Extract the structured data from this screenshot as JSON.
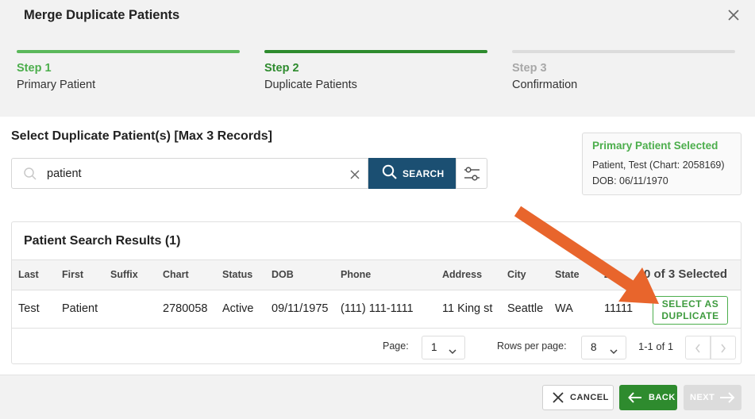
{
  "dialog": {
    "title": "Merge Duplicate Patients"
  },
  "steps": [
    {
      "number": "Step 1",
      "label": "Primary Patient",
      "state": "complete"
    },
    {
      "number": "Step 2",
      "label": "Duplicate Patients",
      "state": "active"
    },
    {
      "number": "Step 3",
      "label": "Confirmation",
      "state": "pending"
    }
  ],
  "search": {
    "section_title": "Select Duplicate Patient(s) [Max 3 Records]",
    "value": "patient",
    "button_label": "SEARCH"
  },
  "primary_patient": {
    "title": "Primary Patient Selected",
    "name": "Patient, Test (Chart: 2058169)",
    "dob": "DOB: 06/11/1970"
  },
  "results": {
    "title": "Patient Search Results (1)",
    "columns": [
      "Last",
      "First",
      "Suffix",
      "Chart",
      "Status",
      "DOB",
      "Phone",
      "Address",
      "City",
      "State",
      "Zip"
    ],
    "selected_count": "0 of 3 Selected",
    "rows": [
      {
        "last": "Test",
        "first": "Patient",
        "suffix": "",
        "chart": "2780058",
        "status": "Active",
        "dob": "09/11/1975",
        "phone": "(111) 111-1111",
        "address": "11 King st",
        "city": "Seattle",
        "state": "WA",
        "zip": "11111",
        "action": "SELECT AS DUPLICATE"
      }
    ]
  },
  "pagination": {
    "page_label": "Page:",
    "page_value": "1",
    "rows_label": "Rows per page:",
    "rows_value": "8",
    "range": "1-1 of 1"
  },
  "footer": {
    "cancel": "CANCEL",
    "back": "BACK",
    "next": "NEXT"
  },
  "colors": {
    "accent_green": "#2e8b2e",
    "light_green": "#4cae4c",
    "search_blue": "#1b4f72",
    "annotation_arrow": "#e8652c"
  }
}
